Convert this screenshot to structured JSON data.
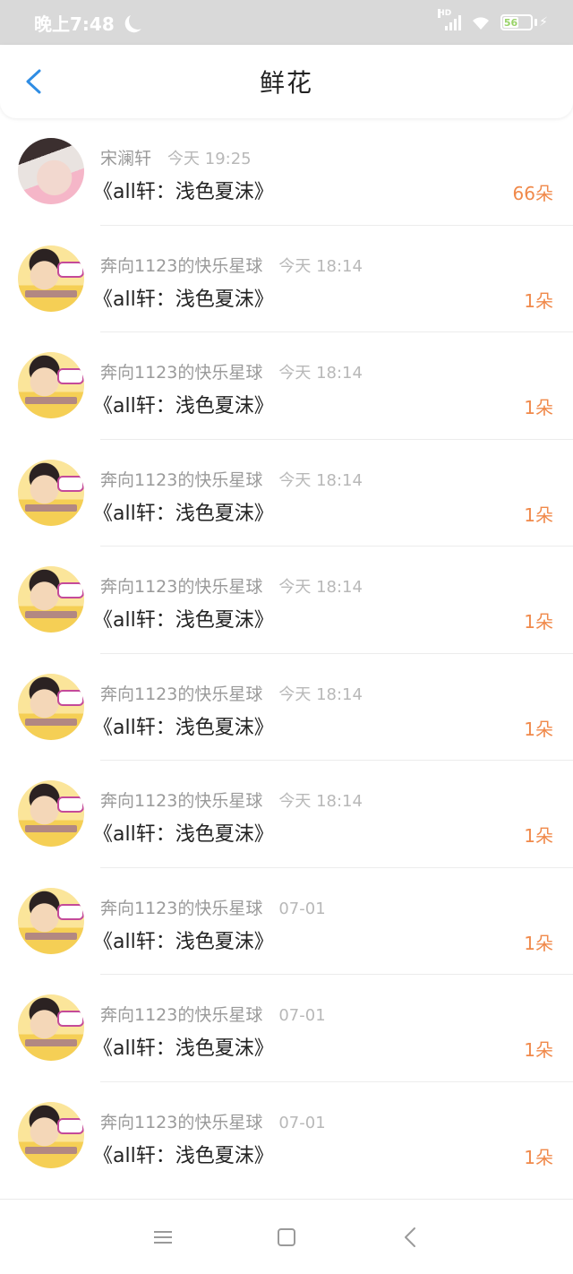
{
  "status_bar": {
    "time": "晚上7:48",
    "network": "HD",
    "battery": "56"
  },
  "nav": {
    "title": "鲜花"
  },
  "colors": {
    "accent": "#2f8de4",
    "count": "#f0894a"
  },
  "records": [
    {
      "name": "宋澜轩",
      "time": "今天 19:25",
      "title": "《all轩：浅色夏沫》",
      "count": "66朵"
    },
    {
      "name": "奔向1123的快乐星球",
      "time": "今天 18:14",
      "title": "《all轩：浅色夏沫》",
      "count": "1朵"
    },
    {
      "name": "奔向1123的快乐星球",
      "time": "今天 18:14",
      "title": "《all轩：浅色夏沫》",
      "count": "1朵"
    },
    {
      "name": "奔向1123的快乐星球",
      "time": "今天 18:14",
      "title": "《all轩：浅色夏沫》",
      "count": "1朵"
    },
    {
      "name": "奔向1123的快乐星球",
      "time": "今天 18:14",
      "title": "《all轩：浅色夏沫》",
      "count": "1朵"
    },
    {
      "name": "奔向1123的快乐星球",
      "time": "今天 18:14",
      "title": "《all轩：浅色夏沫》",
      "count": "1朵"
    },
    {
      "name": "奔向1123的快乐星球",
      "time": "今天 18:14",
      "title": "《all轩：浅色夏沫》",
      "count": "1朵"
    },
    {
      "name": "奔向1123的快乐星球",
      "time": "07-01",
      "title": "《all轩：浅色夏沫》",
      "count": "1朵"
    },
    {
      "name": "奔向1123的快乐星球",
      "time": "07-01",
      "title": "《all轩：浅色夏沫》",
      "count": "1朵"
    },
    {
      "name": "奔向1123的快乐星球",
      "time": "07-01",
      "title": "《all轩：浅色夏沫》",
      "count": "1朵"
    }
  ],
  "icons": {
    "back": "chevron-left-icon",
    "menu": "menu-icon",
    "home": "home-square-icon",
    "nav_back": "system-back-icon"
  }
}
